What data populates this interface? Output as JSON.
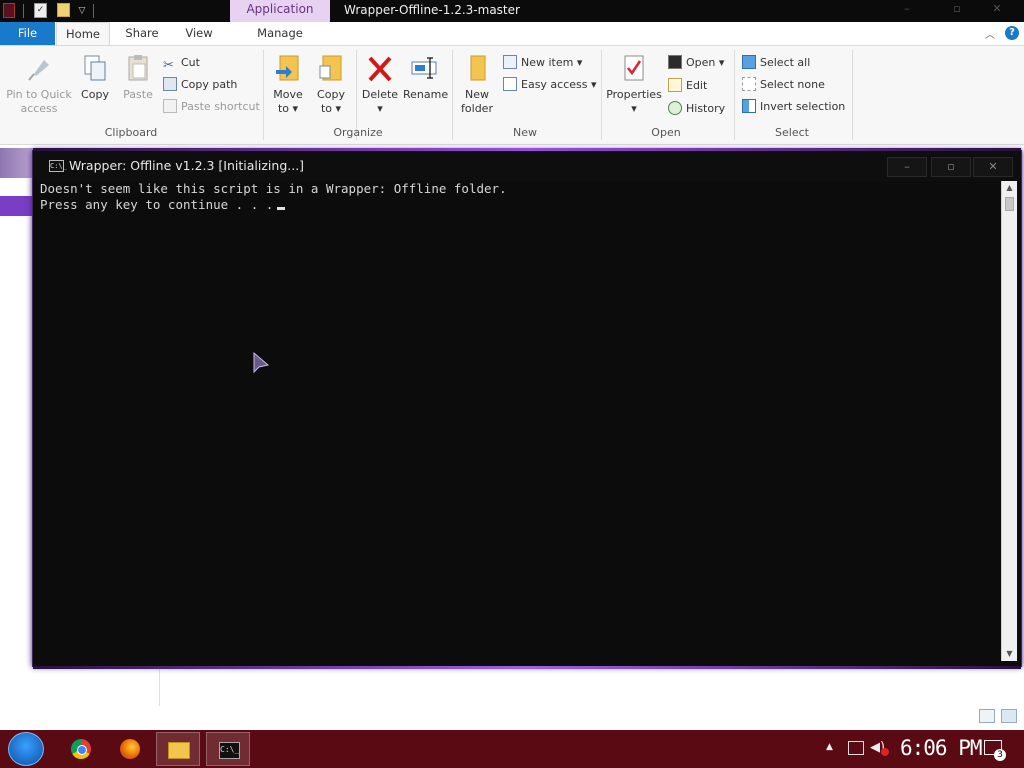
{
  "explorer": {
    "title": "Wrapper-Offline-1.2.3-master",
    "contextual_tab": "Application Tools",
    "tabs": {
      "file": "File",
      "home": "Home",
      "share": "Share",
      "view": "View",
      "manage": "Manage"
    },
    "ribbon": {
      "clipboard": {
        "label": "Clipboard",
        "pin_line1": "Pin to Quick",
        "pin_line2": "access",
        "copy": "Copy",
        "paste": "Paste",
        "cut": "Cut",
        "copy_path": "Copy path",
        "paste_shortcut": "Paste shortcut"
      },
      "organize": {
        "label": "Organize",
        "move_line1": "Move",
        "move_line2": "to",
        "copy_line1": "Copy",
        "copy_line2": "to",
        "delete": "Delete",
        "rename": "Rename"
      },
      "new": {
        "label": "New",
        "folder_line1": "New",
        "folder_line2": "folder",
        "new_item": "New item",
        "easy_access": "Easy access"
      },
      "open": {
        "label": "Open",
        "properties": "Properties",
        "open": "Open",
        "edit": "Edit",
        "history": "History"
      },
      "select": {
        "label": "Select",
        "select_all": "Select all",
        "select_none": "Select none",
        "invert": "Invert selection"
      }
    }
  },
  "console": {
    "title": "Wrapper: Offline v1.2.3 [Initializing...]",
    "icon_text": "C:\\_",
    "lines": [
      "Doesn't seem like this script is in a Wrapper: Offline folder.",
      "Press any key to continue . . ."
    ]
  },
  "taskbar": {
    "apps": [
      "chrome",
      "firefox",
      "file-explorer",
      "command-prompt"
    ],
    "clock": "6:06 PM",
    "notification_count": "3"
  },
  "colors": {
    "file_tab": "#1979ca",
    "contextual_tab": "#e7d3f1",
    "taskbar": "#5a0a12",
    "console_bg": "#0c0c0c",
    "accent_glow": "#9a4de0"
  }
}
